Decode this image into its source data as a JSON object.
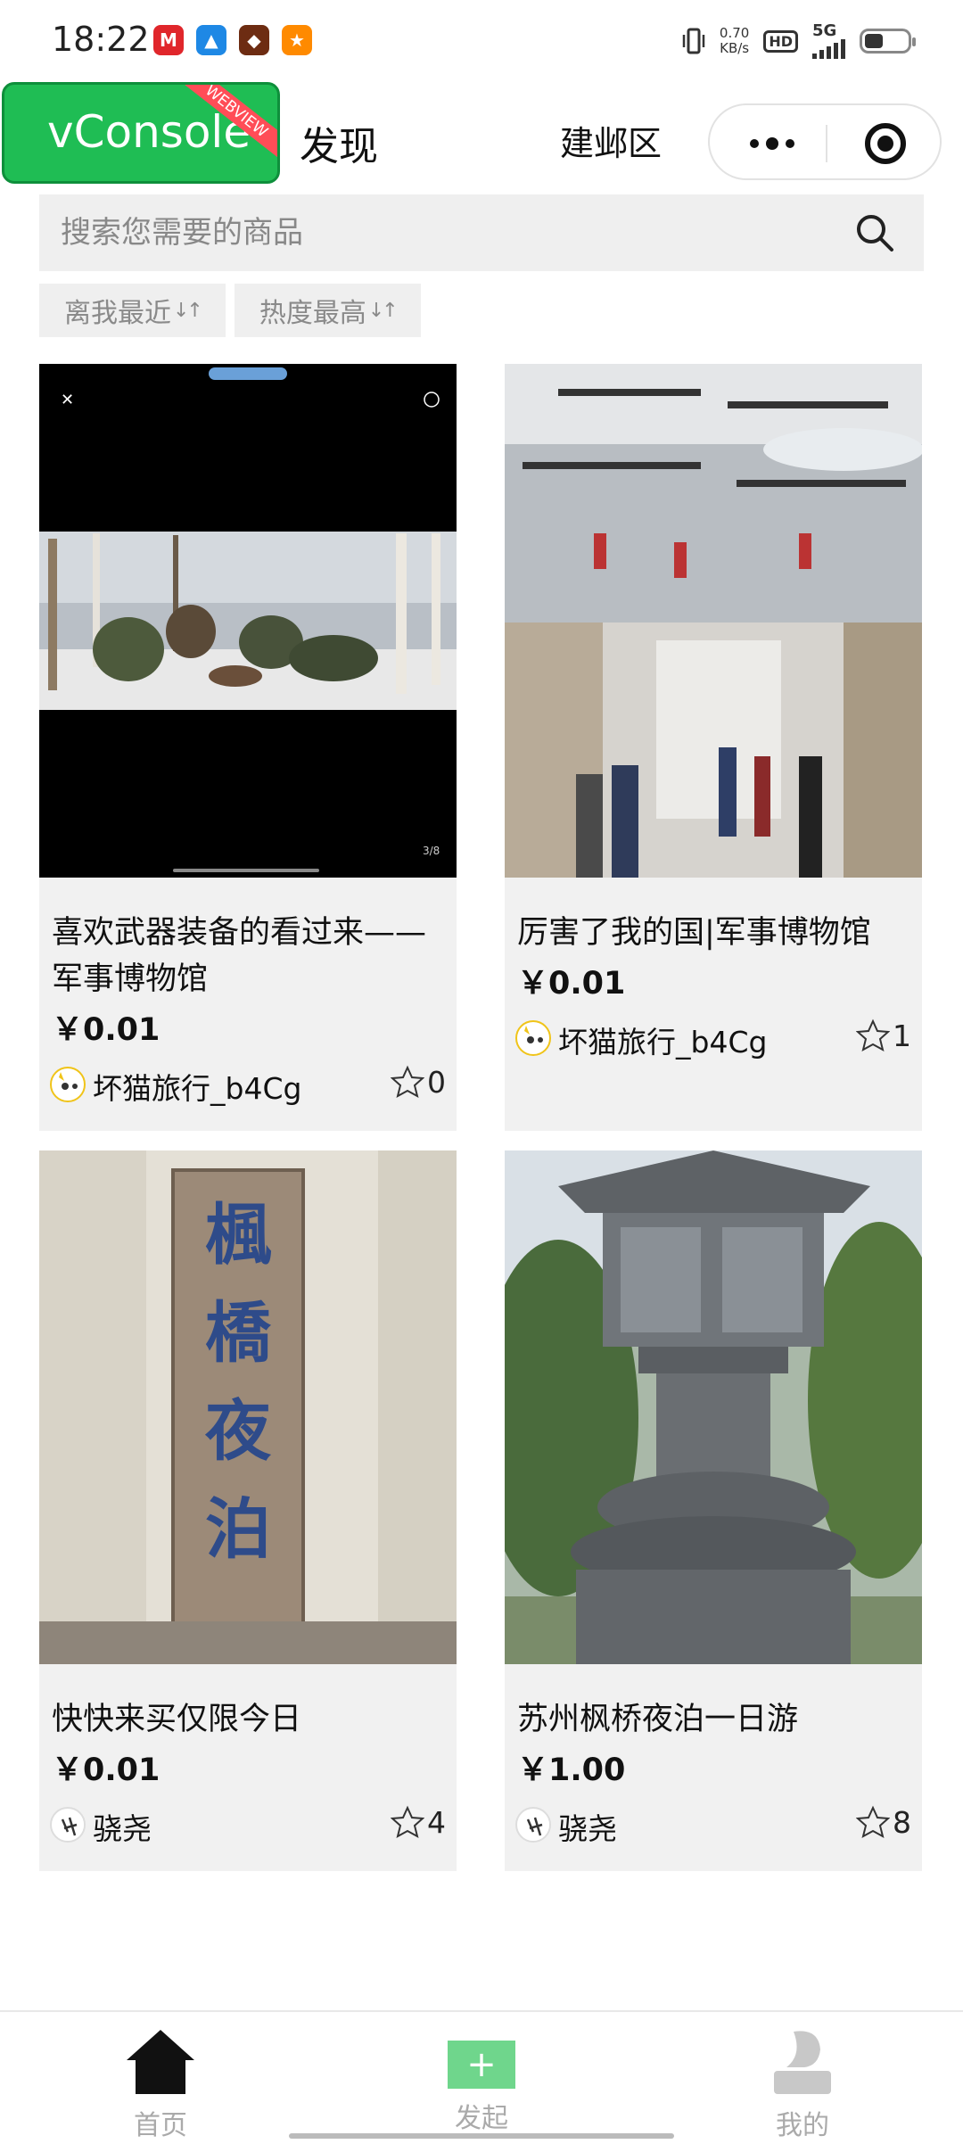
{
  "status_bar": {
    "time": "18:22",
    "net_speed_value": "0.70",
    "net_speed_unit": "KB/s",
    "hd": "HD",
    "network": "5G",
    "apps": [
      {
        "icon": "metro-app-icon",
        "color": "#e0262b",
        "glyph": "M"
      },
      {
        "icon": "navigation-app-icon",
        "color": "#1e88e5",
        "glyph": "▲"
      },
      {
        "icon": "game-app-icon",
        "color": "#6d2c12",
        "glyph": "◆"
      },
      {
        "icon": "shopping-app-icon",
        "color": "#ff8a00",
        "glyph": "★"
      }
    ]
  },
  "nav": {
    "vconsole_label": "vConsole",
    "vconsole_ribbon": "WEBVIEW",
    "title": "发现",
    "district": "建邺区"
  },
  "search": {
    "placeholder": "搜索您需要的商品"
  },
  "sort": {
    "nearest": "离我最近",
    "hottest": "热度最高",
    "arrows": "↓↑"
  },
  "products": [
    {
      "title": "喜欢武器装备的看过来——军事博物馆",
      "price": "￥0.01",
      "author": "坏猫旅行_b4Cg",
      "likes": "0",
      "avatar": "cat-avatar"
    },
    {
      "title": "厉害了我的国|军事博物馆",
      "price": "￥0.01",
      "author": "坏猫旅行_b4Cg",
      "likes": "1",
      "avatar": "cat-avatar"
    },
    {
      "title": "快快来买仅限今日",
      "price": "￥0.01",
      "author": "骁尧",
      "likes": "4",
      "avatar": "calligraphy-avatar"
    },
    {
      "title": "苏州枫桥夜泊一日游",
      "price": "￥1.00",
      "author": "骁尧",
      "likes": "8",
      "avatar": "calligraphy-avatar"
    }
  ],
  "stele_text": "楓橋夜泊",
  "video_indicator": "3/8",
  "tabs": {
    "home": "首页",
    "post": "发起",
    "mine": "我的",
    "post_plus": "+"
  },
  "colors": {
    "accent_green": "#1fbd54",
    "card_bg": "#f1f1f1",
    "webview_red": "#ff4d57"
  }
}
